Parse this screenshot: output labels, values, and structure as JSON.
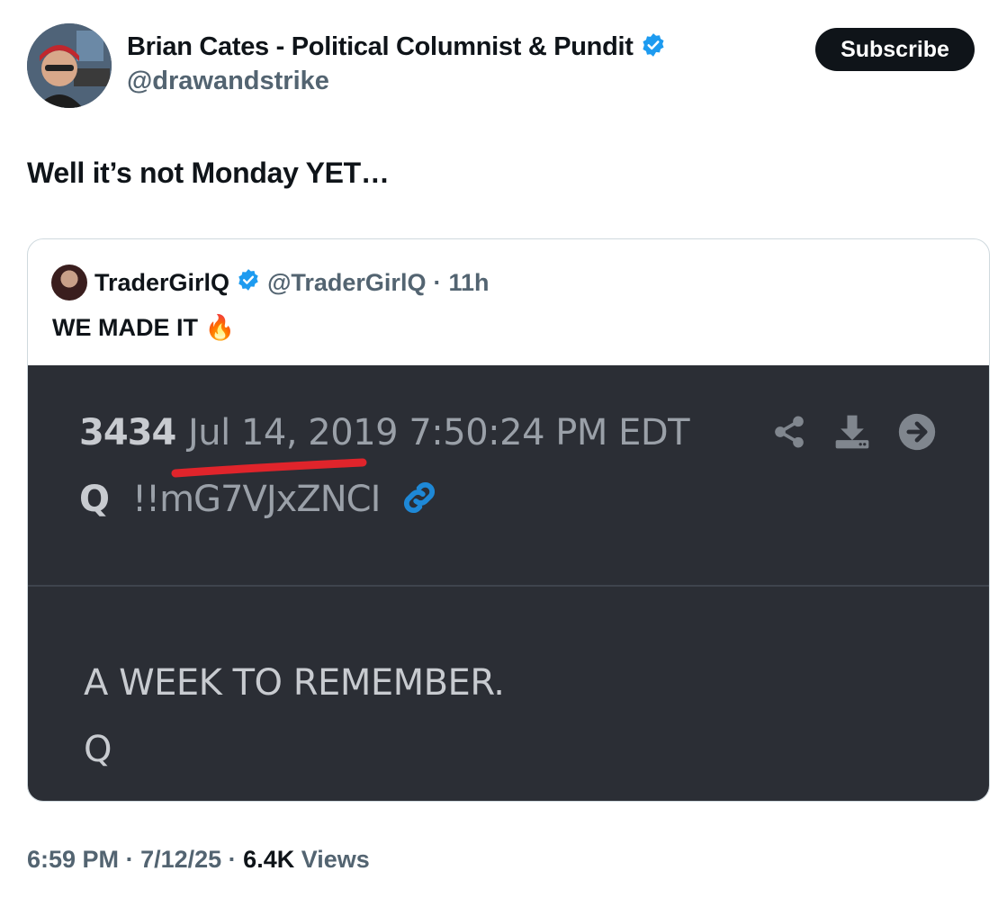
{
  "author": {
    "name": "Brian Cates - Political Columnist & Pundit",
    "handle": "@drawandstrike",
    "verified": true
  },
  "subscribe_label": "Subscribe",
  "tweet": {
    "text": "Well it’s not Monday YET…",
    "time": "6:59 PM",
    "date": "7/12/25",
    "views_count": "6.4K",
    "views_label": "Views"
  },
  "quote": {
    "name": "TraderGirlQ",
    "handle": "@TraderGirlQ",
    "age": "11h",
    "text": "WE MADE IT 🔥",
    "image": {
      "post_number": "3434",
      "post_date": "Jul 14, 2019 7:50:24 PM EDT",
      "author": "Q",
      "tripcode": "!!mG7VJxZNCI",
      "body_line1": "A WEEK TO REMEMBER.",
      "body_line2": "Q"
    }
  },
  "colors": {
    "verified": "#1d9bf0",
    "underline": "#e0242b",
    "image_bg": "#2b2e35"
  }
}
